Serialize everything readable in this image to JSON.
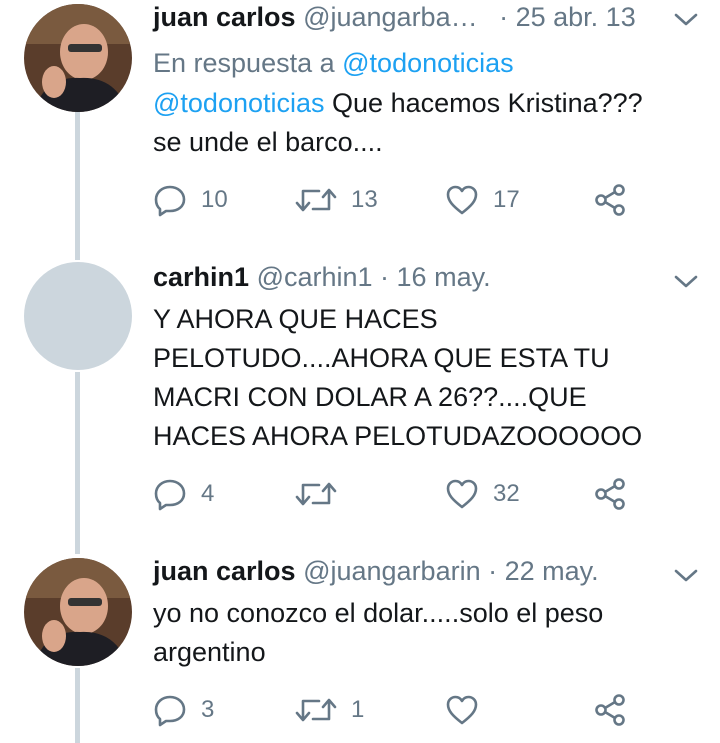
{
  "tweets": [
    {
      "name": "juan carlos",
      "handle": "@juangarba…",
      "date": "· 25 abr. 13",
      "reply_prefix": "En respuesta a",
      "reply_handle": "@todonoticias",
      "mention": "@todonoticias",
      "text_after_mention": "Que hacemos Kristina???",
      "text_line2": "se unde el barco....",
      "replies": "10",
      "retweets": "13",
      "likes": "17"
    },
    {
      "name": "carhin1",
      "handle": "@carhin1",
      "date": "· 16 may.",
      "lines": [
        "Y AHORA QUE HACES",
        "PELOTUDO....AHORA QUE ESTA TU",
        "MACRI CON DOLAR A 26??....QUE",
        "HACES AHORA PELOTUDAZOOOOOO"
      ],
      "replies": "4",
      "retweets": "",
      "likes": "32"
    },
    {
      "name": "juan carlos",
      "handle": "@juangarbarin",
      "date": "· 22 may.",
      "lines": [
        "yo no conozco el dolar.....solo el peso",
        "argentino"
      ],
      "replies": "3",
      "retweets": "1",
      "likes": ""
    }
  ],
  "icons": {
    "reply": "reply-icon",
    "retweet": "retweet-icon",
    "like": "heart-icon",
    "share": "share-icon",
    "more": "chevron-down-icon"
  },
  "colors": {
    "text": "#14171a",
    "muted": "#657786",
    "link": "#1da1f2",
    "thread_line": "#ccd6dd"
  }
}
